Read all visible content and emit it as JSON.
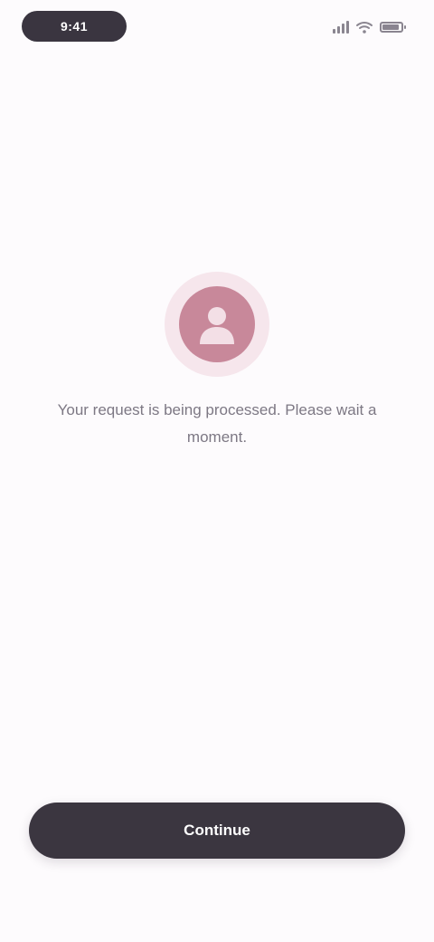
{
  "status_bar": {
    "time": "9:41",
    "icons": [
      "signal-icon",
      "wifi-icon",
      "battery-icon"
    ],
    "battery_level": 0.8
  },
  "main": {
    "avatar_icon": "user-icon",
    "message": "Your request is being processed. Please wait a moment."
  },
  "footer": {
    "button_label": "Continue"
  },
  "colors": {
    "background": "#fdfbfd",
    "accent": "#c8889a",
    "accent_light": "#f6e6ec",
    "button": "#3b3640",
    "text_muted": "#7d7884"
  }
}
